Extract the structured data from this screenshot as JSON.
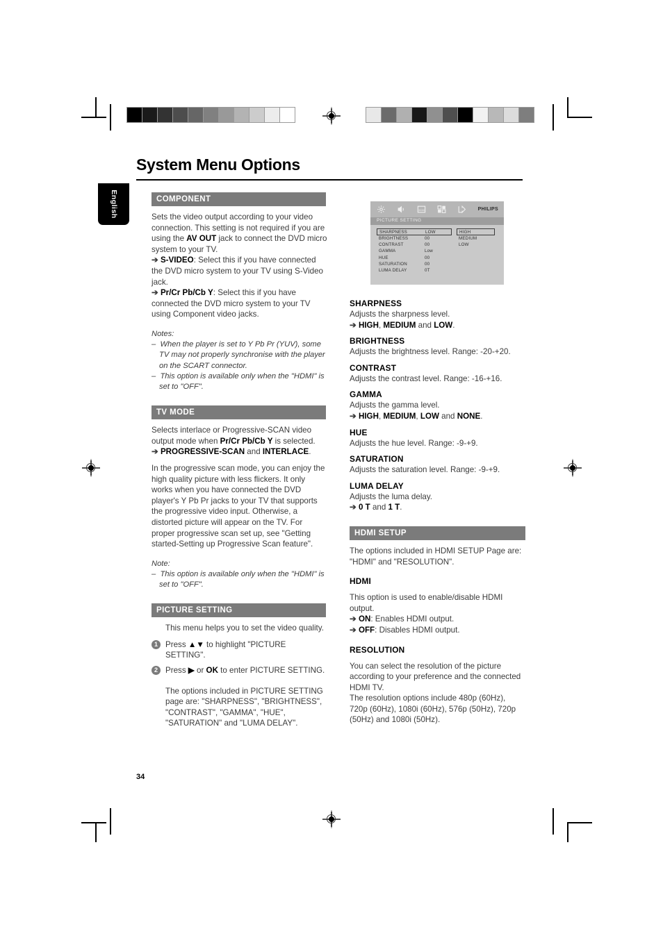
{
  "page": {
    "title": "System Menu Options",
    "language_tab": "English",
    "page_number": "34"
  },
  "calibration": {
    "left_bar": [
      "#000000",
      "#1a1a1a",
      "#333333",
      "#4d4d4d",
      "#666666",
      "#808080",
      "#999999",
      "#b3b3b3",
      "#cccccc",
      "#ececec",
      "#ffffff"
    ],
    "right_bar": [
      "#e8e8e8",
      "#6b6b6b",
      "#b0b0b0",
      "#181818",
      "#909090",
      "#4f4f4f",
      "#000000",
      "#f2f2f2",
      "#b8b8b8",
      "#dcdcdc",
      "#7e7e7e"
    ]
  },
  "left_column": {
    "component": {
      "heading": "COMPONENT",
      "para1_a": "Sets the video output according to your video connection. This setting is not required if you are using the ",
      "para1_b": "AV OUT",
      "para1_c": " jack to connect the DVD micro system to your TV.",
      "bullet1_key": "S-VIDEO",
      "bullet1_text": ": Select this if you have connected the DVD micro system to your TV using S-Video jack.",
      "bullet2_key": "Pr/Cr Pb/Cb Y",
      "bullet2_text": ": Select this if you have connected the DVD micro system to your TV using Component video jacks.",
      "notes_label": "Notes:",
      "note1": "When the player is set to Y Pb Pr (YUV), some TV may not properly synchronise with the player on the SCART connector.",
      "note2": "This option is available only when the \"HDMI\" is set to \"OFF\"."
    },
    "tv_mode": {
      "heading": "TV MODE",
      "para1_a": "Selects interlace or Progressive-SCAN video output mode when ",
      "para1_b": "Pr/Cr Pb/Cb Y",
      "para1_c": " is selected.",
      "bullet_key_a": "PROGRESSIVE-SCAN",
      "bullet_mid": " and ",
      "bullet_key_b": "INTERLACE",
      "bullet_end": ".",
      "para2": "In the progressive scan mode, you can enjoy the high quality picture with less flickers. It only works when you have connected the DVD player's Y Pb Pr jacks to your TV that supports the progressive video input. Otherwise, a distorted picture will appear on the TV. For proper progressive scan set up, see \"Getting started-Setting up Progressive Scan feature\".",
      "note_label": "Note:",
      "note1": "This option is available only when the \"HDMI\" is set to \"OFF\"."
    },
    "picture_setting": {
      "heading": "PICTURE SETTING",
      "intro": "This menu helps you to set the video quality.",
      "step1_num": "1",
      "step1_a": "Press ",
      "step1_arrows": "▲▼",
      "step1_b": "  to highlight \"PICTURE SETTING\".",
      "step2_num": "2",
      "step2_a": "Press ",
      "step2_arrow": "▶",
      "step2_b": " or ",
      "step2_key": "OK",
      "step2_c": " to enter PICTURE SETTING.",
      "options_text": "The options included in PICTURE SETTING page are: \"SHARPNESS\", \"BRIGHTNESS\", \"CONTRAST\", \"GAMMA\", \"HUE\", \"SATURATION\" and \"LUMA DELAY\"."
    }
  },
  "osd": {
    "brand": "PHILIPS",
    "title": "PICTURE SETTING",
    "icons": [
      "gear-icon",
      "speaker-icon",
      "screen-icon",
      "grid-icon",
      "exit-icon"
    ],
    "rows": [
      {
        "label": "SHARPNESS",
        "value": "LOW",
        "selected": true
      },
      {
        "label": "BRIGHTNESS",
        "value": "00",
        "selected": false
      },
      {
        "label": "CONTRAST",
        "value": "00",
        "selected": false
      },
      {
        "label": "GAMMA",
        "value": "Low",
        "selected": false
      },
      {
        "label": "HUE",
        "value": "00",
        "selected": false
      },
      {
        "label": "SATURATION",
        "value": "00",
        "selected": false
      },
      {
        "label": "LUMA DELAY",
        "value": "0T",
        "selected": false
      }
    ],
    "options": [
      {
        "label": "HIGH",
        "selected": true
      },
      {
        "label": "MEDIUM",
        "selected": false
      },
      {
        "label": "LOW",
        "selected": false
      }
    ]
  },
  "right_column": {
    "sharpness": {
      "heading": "SHARPNESS",
      "desc": "Adjusts the sharpness level.",
      "opt_a": "HIGH",
      "opt_sep1": ", ",
      "opt_b": "MEDIUM",
      "opt_sep2": " and ",
      "opt_c": "LOW",
      "opt_end": "."
    },
    "brightness": {
      "heading": "BRIGHTNESS",
      "desc": "Adjusts the brightness level. Range: -20-+20."
    },
    "contrast": {
      "heading": "CONTRAST",
      "desc": "Adjusts the contrast level. Range: -16-+16."
    },
    "gamma": {
      "heading": "GAMMA",
      "desc": "Adjusts the gamma level.",
      "opt_a": "HIGH",
      "opt_sep1": ", ",
      "opt_b": "MEDIUM",
      "opt_sep2": ", ",
      "opt_c": "LOW",
      "opt_sep3": " and ",
      "opt_d": "NONE",
      "opt_end": "."
    },
    "hue": {
      "heading": "HUE",
      "desc": "Adjusts the hue level. Range: -9-+9."
    },
    "saturation": {
      "heading": "SATURATION",
      "desc": "Adjusts the saturation level. Range: -9-+9."
    },
    "luma_delay": {
      "heading": "LUMA DELAY",
      "desc": "Adjusts the luma delay.",
      "opt_a": "0 T",
      "opt_sep": " and ",
      "opt_b": "1 T",
      "opt_end": "."
    },
    "hdmi_setup": {
      "heading": "HDMI SETUP",
      "desc": "The options included in HDMI SETUP Page are: \"HDMI\" and \"RESOLUTION\"."
    },
    "hdmi": {
      "heading": "HDMI",
      "desc": "This option is used to enable/disable HDMI output.",
      "opt_a_key": "ON",
      "opt_a_text": ": Enables HDMI output.",
      "opt_b_key": "OFF",
      "opt_b_text": ": Disables HDMI output."
    },
    "resolution": {
      "heading": "RESOLUTION",
      "desc1": "You can select the resolution of the picture according to your preference and the connected HDMI TV.",
      "desc2": "The resolution options include 480p (60Hz), 720p (60Hz), 1080i (60Hz), 576p (50Hz), 720p (50Hz) and 1080i (50Hz)."
    }
  }
}
